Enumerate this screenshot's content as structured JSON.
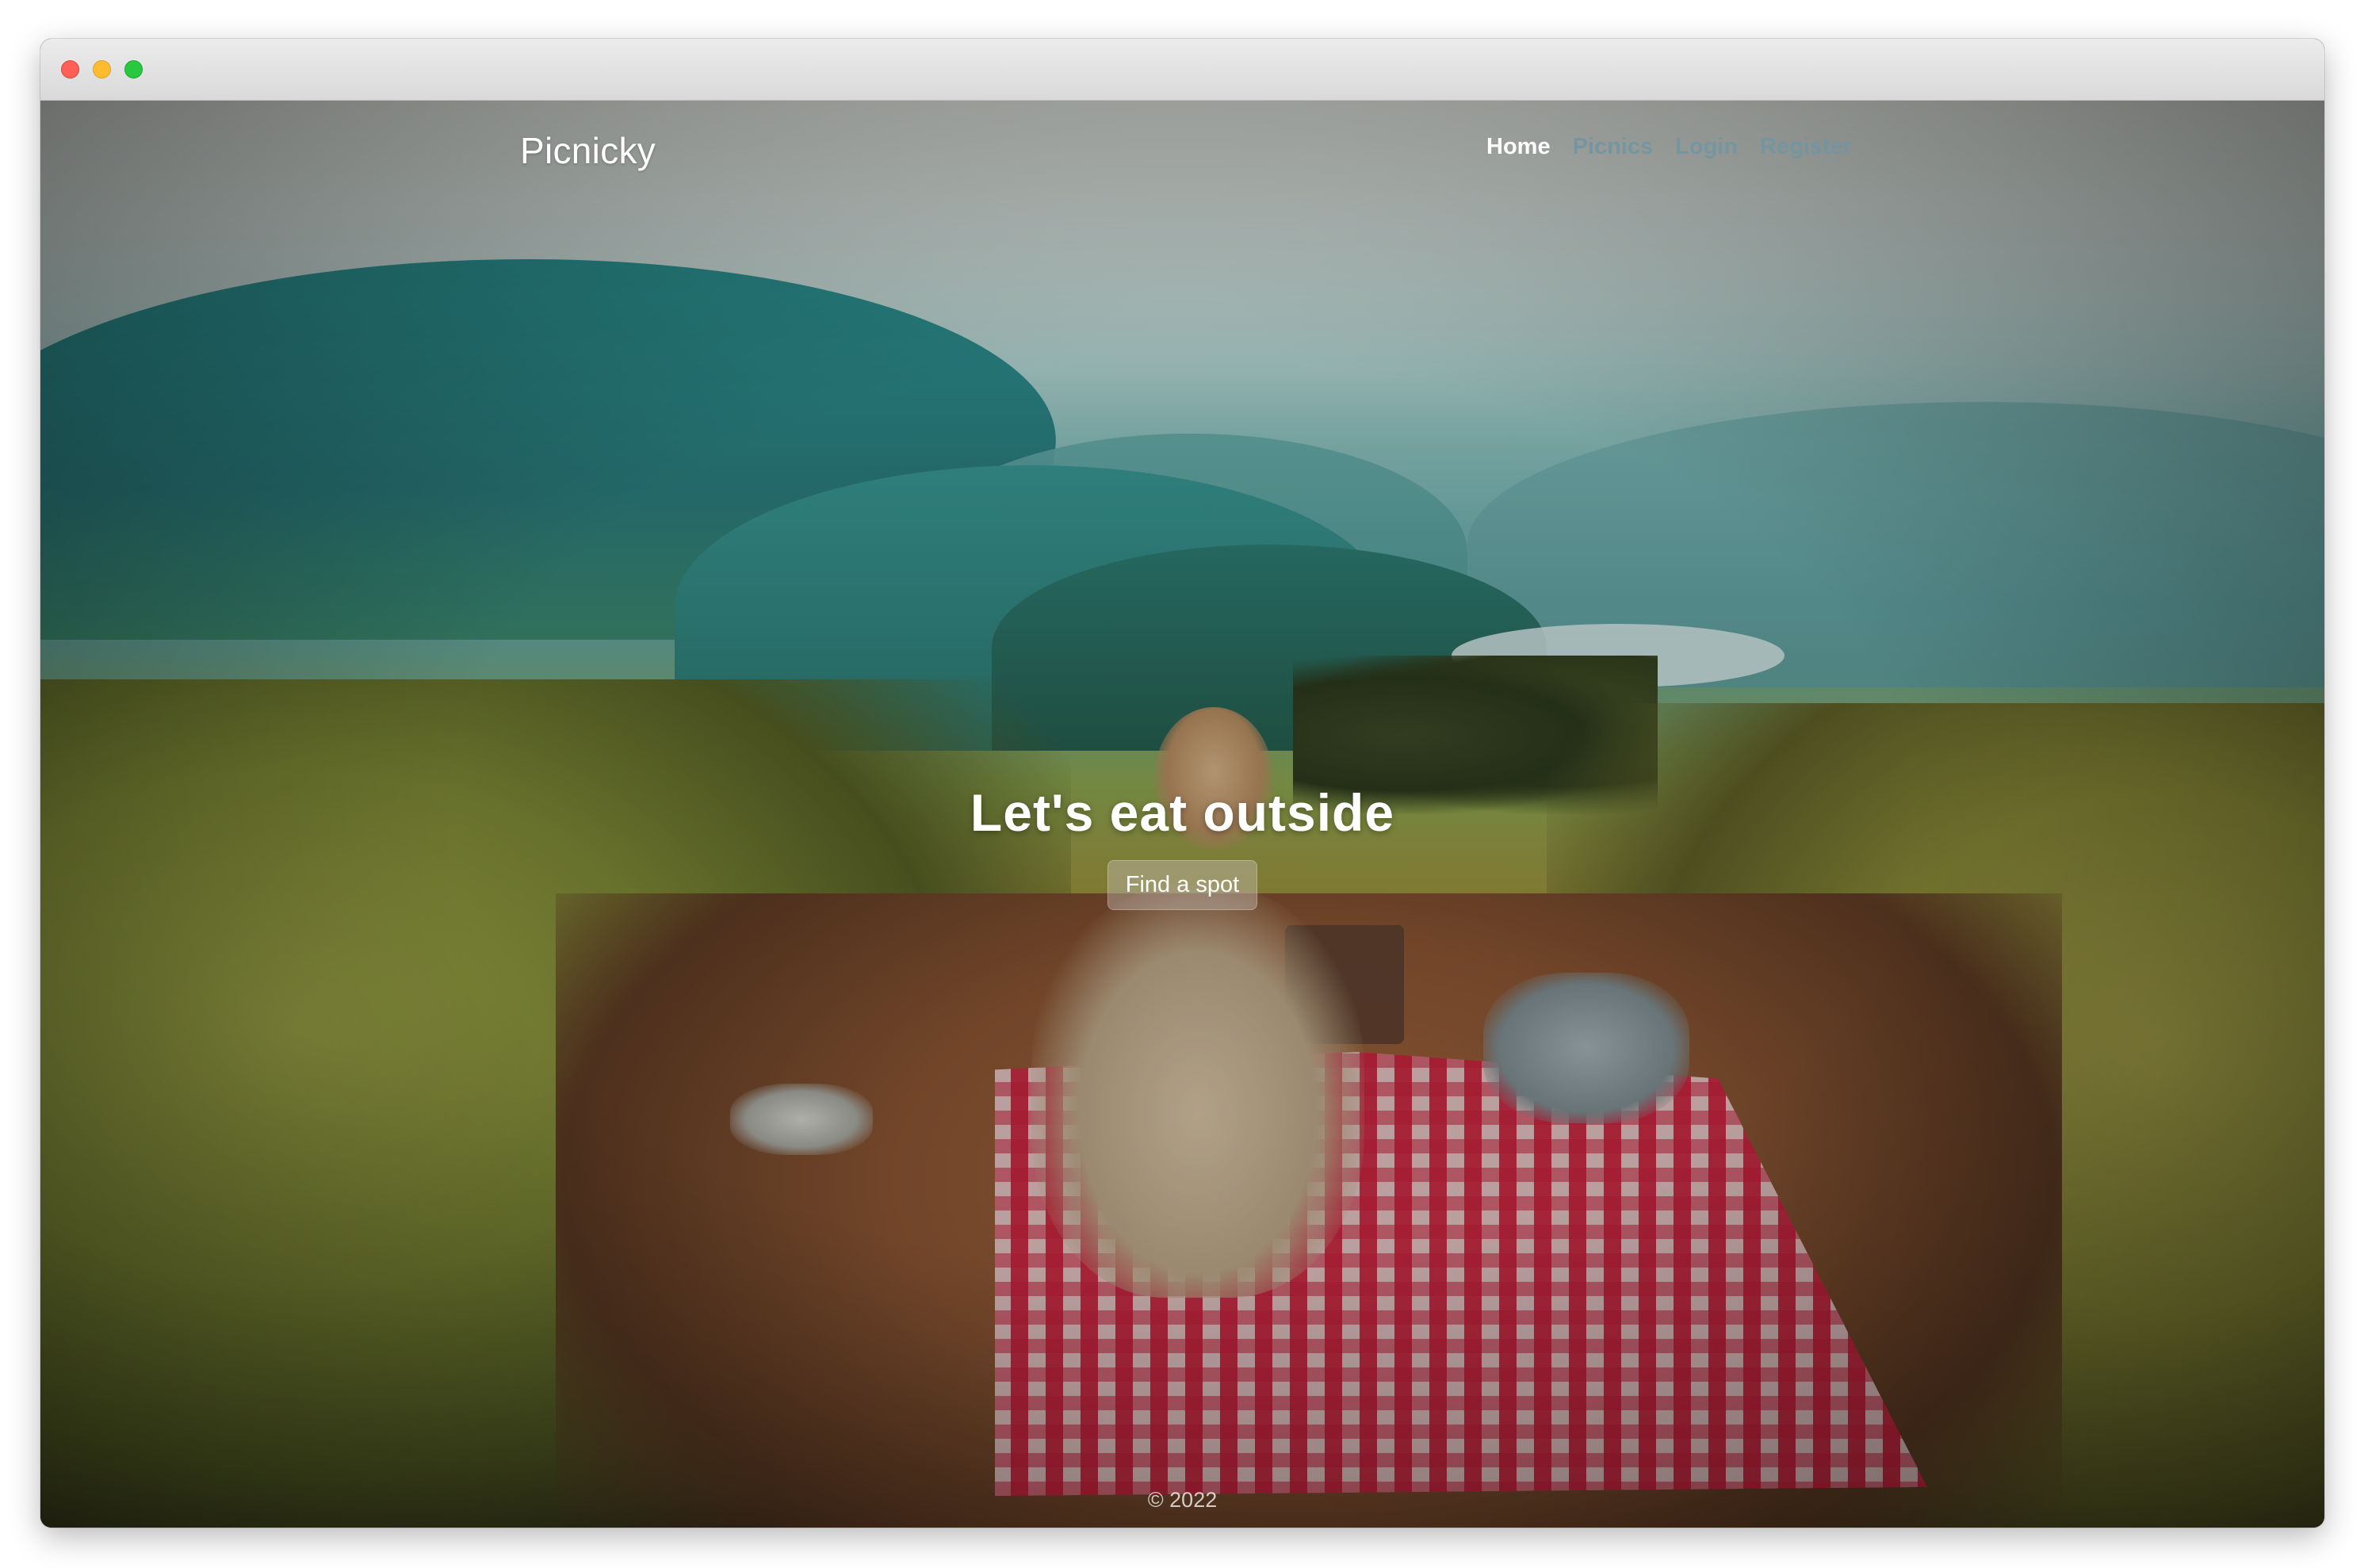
{
  "window": {
    "controls": [
      "close",
      "minimize",
      "maximize"
    ]
  },
  "navbar": {
    "brand": "Picnicky",
    "links": [
      {
        "label": "Home",
        "active": true
      },
      {
        "label": "Picnics",
        "active": false
      },
      {
        "label": "Login",
        "active": false
      },
      {
        "label": "Register",
        "active": false
      }
    ]
  },
  "hero": {
    "title": "Let's eat outside",
    "button_label": "Find a spot"
  },
  "footer": {
    "text": "© 2022"
  },
  "colors": {
    "nav_active": "#ffffff",
    "nav_inactive": "#7396a0",
    "button_bg": "#c8beb9"
  }
}
